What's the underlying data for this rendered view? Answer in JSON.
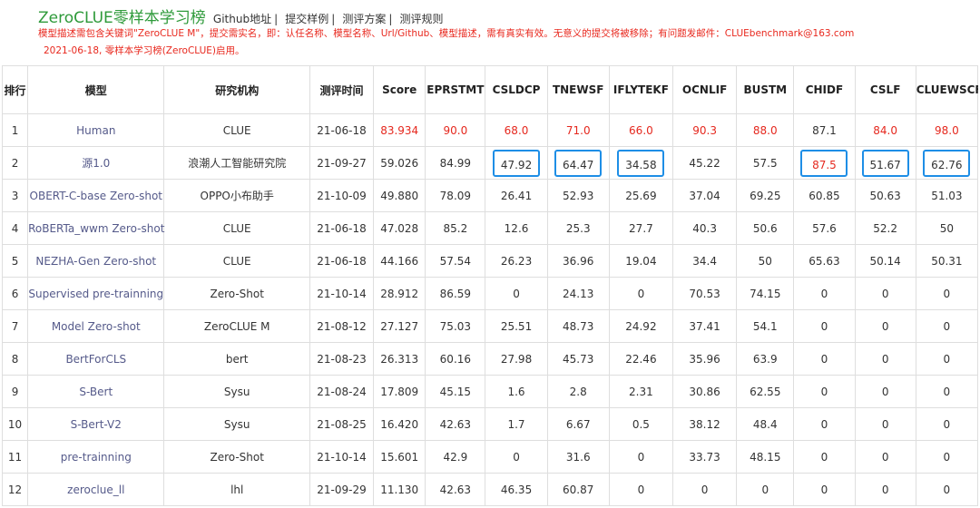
{
  "header": {
    "title": "ZeroCLUE零样本学习榜",
    "nav": [
      "Github地址",
      "提交样例",
      "测评方案",
      "测评规则"
    ],
    "separator": "|",
    "notice1": "模型描述需包含关键词\"ZeroCLUE M\"，提交需实名，即：认任名称、模型名称、Url/Github、模型描述，需有真实有效。无意义的提交将被移除；有问题发邮件：CLUEbenchmark@163.com",
    "notice2": "2021-06-18, 零样本学习榜(ZeroCLUE)启用。"
  },
  "table": {
    "columns": [
      "排行",
      "模型",
      "研究机构",
      "测评时间",
      "Score",
      "EPRSTMT",
      "CSLDCP",
      "TNEWSF",
      "IFLYTEKF",
      "OCNLIF",
      "BUSTM",
      "CHIDF",
      "CSLF",
      "CLUEWSCF"
    ],
    "rows": [
      [
        "1",
        "Human",
        "CLUE",
        "21-06-18",
        "83.934",
        "90.0",
        "68.0",
        "71.0",
        "66.0",
        "90.3",
        "88.0",
        "87.1",
        "84.0",
        "98.0"
      ],
      [
        "2",
        "源1.0",
        "浪潮人工智能研究院",
        "21-09-27",
        "59.026",
        "84.99",
        "47.92",
        "64.47",
        "34.58",
        "45.22",
        "57.5",
        "87.5",
        "51.67",
        "62.76"
      ],
      [
        "3",
        "OBERT-C-base Zero-shot",
        "OPPO小布助手",
        "21-10-09",
        "49.880",
        "78.09",
        "26.41",
        "52.93",
        "25.69",
        "37.04",
        "69.25",
        "60.85",
        "50.63",
        "51.03"
      ],
      [
        "4",
        "RoBERTa_wwm Zero-shot",
        "CLUE",
        "21-06-18",
        "47.028",
        "85.2",
        "12.6",
        "25.3",
        "27.7",
        "40.3",
        "50.6",
        "57.6",
        "52.2",
        "50"
      ],
      [
        "5",
        "NEZHA-Gen Zero-shot",
        "CLUE",
        "21-06-18",
        "44.166",
        "57.54",
        "26.23",
        "36.96",
        "19.04",
        "34.4",
        "50",
        "65.63",
        "50.14",
        "50.31"
      ],
      [
        "6",
        "Supervised pre-trainning",
        "Zero-Shot",
        "21-10-14",
        "28.912",
        "86.59",
        "0",
        "24.13",
        "0",
        "70.53",
        "74.15",
        "0",
        "0",
        "0"
      ],
      [
        "7",
        "Model Zero-shot",
        "ZeroCLUE M",
        "21-08-12",
        "27.127",
        "75.03",
        "25.51",
        "48.73",
        "24.92",
        "37.41",
        "54.1",
        "0",
        "0",
        "0"
      ],
      [
        "8",
        "BertForCLS",
        "bert",
        "21-08-23",
        "26.313",
        "60.16",
        "27.98",
        "45.73",
        "22.46",
        "35.96",
        "63.9",
        "0",
        "0",
        "0"
      ],
      [
        "9",
        "S-Bert",
        "Sysu",
        "21-08-24",
        "17.809",
        "45.15",
        "1.6",
        "2.8",
        "2.31",
        "30.86",
        "62.55",
        "0",
        "0",
        "0"
      ],
      [
        "10",
        "S-Bert-V2",
        "Sysu",
        "21-08-25",
        "16.420",
        "42.63",
        "1.7",
        "6.67",
        "0.5",
        "38.12",
        "48.4",
        "0",
        "0",
        "0"
      ],
      [
        "11",
        "pre-trainning",
        "Zero-Shot",
        "21-10-14",
        "15.601",
        "42.9",
        "0",
        "31.6",
        "0",
        "33.73",
        "48.15",
        "0",
        "0",
        "0"
      ],
      [
        "12",
        "zeroclue_ll",
        "lhl",
        "21-09-29",
        "11.130",
        "42.63",
        "46.35",
        "60.87",
        "0",
        "0",
        "0",
        "0",
        "0",
        "0"
      ]
    ],
    "red_cells": [
      [
        0,
        4
      ],
      [
        0,
        5
      ],
      [
        0,
        6
      ],
      [
        0,
        7
      ],
      [
        0,
        8
      ],
      [
        0,
        9
      ],
      [
        0,
        10
      ],
      [
        0,
        12
      ],
      [
        0,
        13
      ],
      [
        1,
        11
      ]
    ],
    "highlighted_cells": [
      [
        1,
        6
      ],
      [
        1,
        7
      ],
      [
        1,
        8
      ],
      [
        1,
        11
      ],
      [
        1,
        12
      ],
      [
        1,
        13
      ]
    ]
  },
  "colors": {
    "title": "#2e9a3a",
    "notice": "#e8281e",
    "model_link": "#555a8a",
    "highlight_red": "#e5281e",
    "highlight_box": "#1e8ee6",
    "grid": "#dedede"
  }
}
